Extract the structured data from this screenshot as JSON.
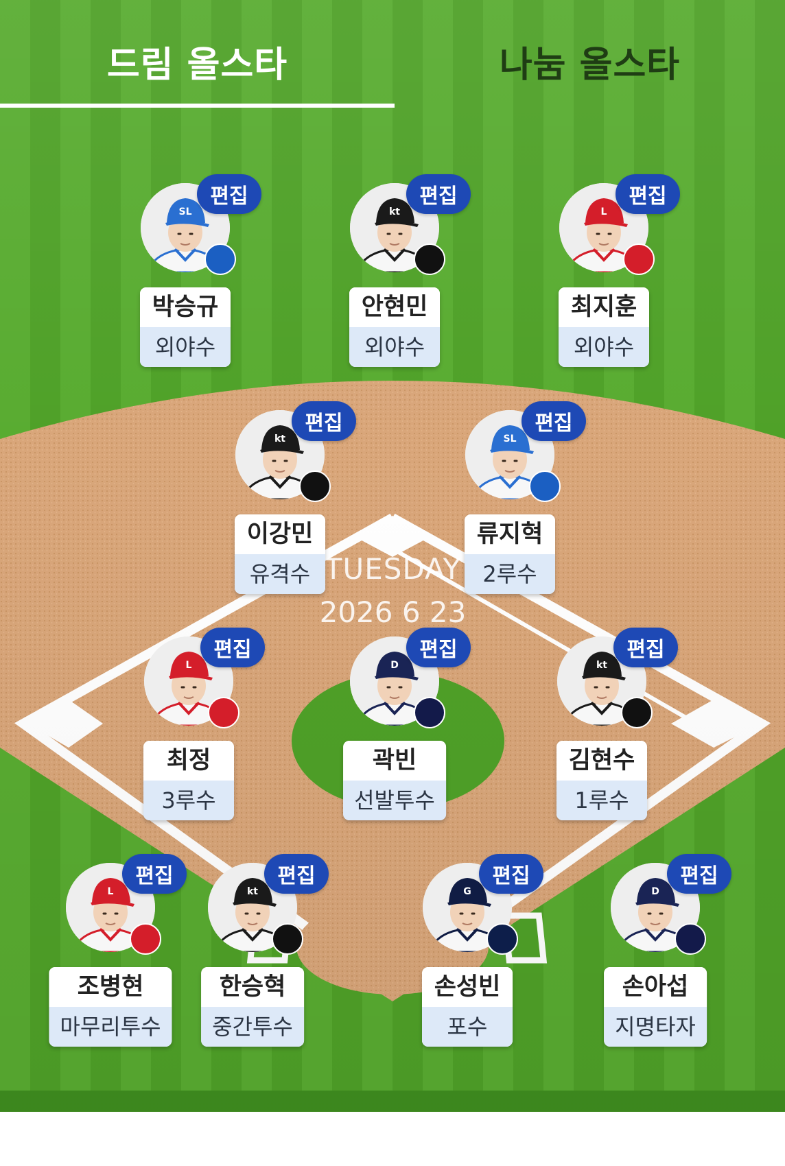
{
  "tabs": {
    "active": "드림 올스타",
    "inactive": "나눔 올스타"
  },
  "date": {
    "day": "TUESDAY",
    "value": "2026 6 23"
  },
  "edit_label": "편집",
  "colors": {
    "edit_button": "#1e49b5",
    "position_bg": "#dde9f8",
    "grass": "#59ac31",
    "dirt": "#d9a67a"
  },
  "players": [
    {
      "name": "박승규",
      "position": "외야수",
      "team": "Lions",
      "team_color": "#1b5fc2",
      "cap_color": "#2a6fd1",
      "cap_letter": "SL"
    },
    {
      "name": "안현민",
      "position": "외야수",
      "team": "kt wiz",
      "team_color": "#111111",
      "cap_color": "#1a1a1a",
      "cap_letter": "kt"
    },
    {
      "name": "최지훈",
      "position": "외야수",
      "team": "Landers",
      "team_color": "#d41e2a",
      "cap_color": "#d41e2a",
      "cap_letter": "L"
    },
    {
      "name": "이강민",
      "position": "유격수",
      "team": "kt wiz",
      "team_color": "#111111",
      "cap_color": "#1a1a1a",
      "cap_letter": "kt"
    },
    {
      "name": "류지혁",
      "position": "2루수",
      "team": "Lions",
      "team_color": "#1b5fc2",
      "cap_color": "#2a6fd1",
      "cap_letter": "SL"
    },
    {
      "name": "최정",
      "position": "3루수",
      "team": "Landers",
      "team_color": "#d41e2a",
      "cap_color": "#d41e2a",
      "cap_letter": "L"
    },
    {
      "name": "곽빈",
      "position": "선발투수",
      "team": "Bears",
      "team_color": "#131a4a",
      "cap_color": "#1a2455",
      "cap_letter": "D"
    },
    {
      "name": "김현수",
      "position": "1루수",
      "team": "kt wiz",
      "team_color": "#111111",
      "cap_color": "#1a1a1a",
      "cap_letter": "kt"
    },
    {
      "name": "조병현",
      "position": "마무리투수",
      "team": "Landers",
      "team_color": "#d41e2a",
      "cap_color": "#d41e2a",
      "cap_letter": "L"
    },
    {
      "name": "한승혁",
      "position": "중간투수",
      "team": "kt wiz",
      "team_color": "#111111",
      "cap_color": "#1a1a1a",
      "cap_letter": "kt"
    },
    {
      "name": "손성빈",
      "position": "포수",
      "team": "Giants",
      "team_color": "#0d1e4a",
      "cap_color": "#101c44",
      "cap_letter": "G"
    },
    {
      "name": "손아섭",
      "position": "지명타자",
      "team": "Bears",
      "team_color": "#131a4a",
      "cap_color": "#1a2455",
      "cap_letter": "D"
    }
  ]
}
